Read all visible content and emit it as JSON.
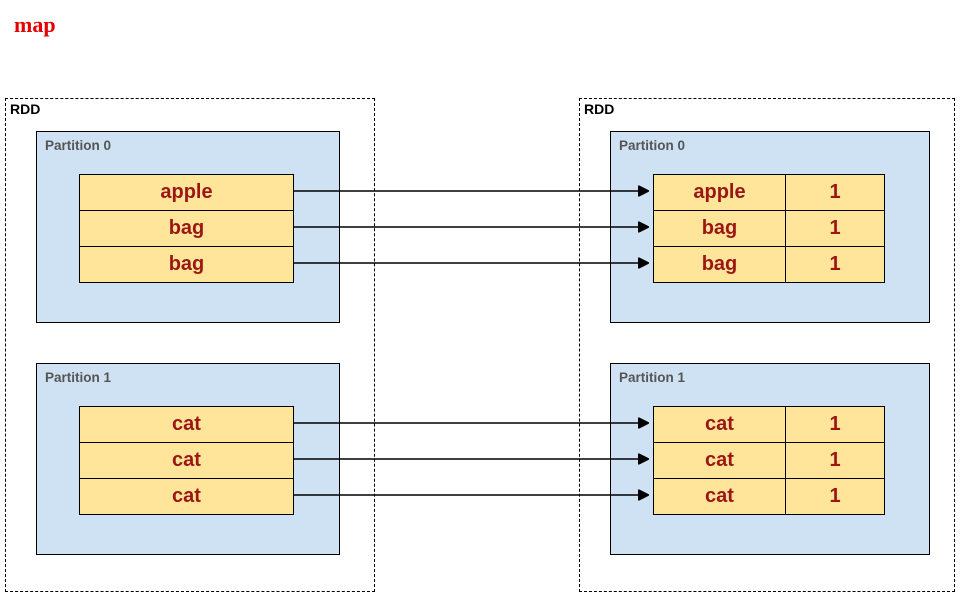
{
  "title": "map",
  "left": {
    "label": "RDD",
    "partitions": [
      {
        "label": "Partition 0",
        "rows": [
          "apple",
          "bag",
          "bag"
        ]
      },
      {
        "label": "Partition 1",
        "rows": [
          "cat",
          "cat",
          "cat"
        ]
      }
    ]
  },
  "right": {
    "label": "RDD",
    "partitions": [
      {
        "label": "Partition 0",
        "rows": [
          [
            "apple",
            "1"
          ],
          [
            "bag",
            "1"
          ],
          [
            "bag",
            "1"
          ]
        ]
      },
      {
        "label": "Partition 1",
        "rows": [
          [
            "cat",
            "1"
          ],
          [
            "cat",
            "1"
          ],
          [
            "cat",
            "1"
          ]
        ]
      }
    ]
  },
  "colors": {
    "title": "#e60000",
    "partition_bg": "#cfe2f3",
    "cell_bg": "#ffe599",
    "cell_text": "#9c1616"
  }
}
